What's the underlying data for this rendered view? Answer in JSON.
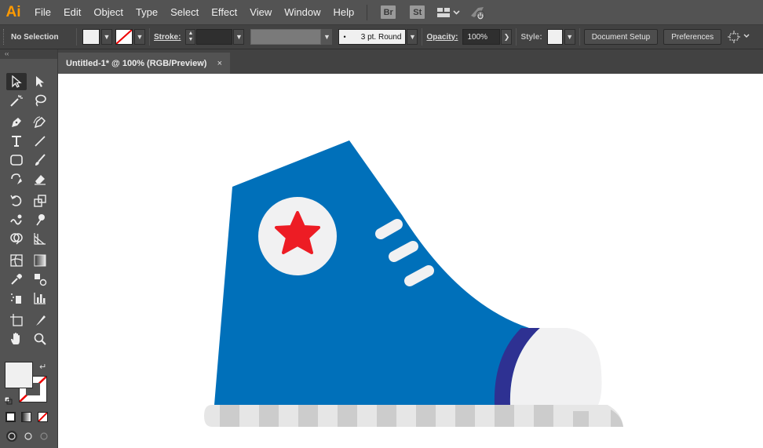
{
  "app": {
    "logo_text": "Ai"
  },
  "menu": {
    "items": [
      "File",
      "Edit",
      "Object",
      "Type",
      "Select",
      "Effect",
      "View",
      "Window",
      "Help"
    ],
    "bridge_label": "Br",
    "stock_label": "St"
  },
  "control_bar": {
    "selection_status": "No Selection",
    "stroke_label": "Stroke:",
    "brush_value": "3 pt. Round",
    "opacity_label": "Opacity:",
    "opacity_value": "100%",
    "style_label": "Style:",
    "document_setup_label": "Document Setup",
    "preferences_label": "Preferences"
  },
  "document": {
    "tab_title": "Untitled-1* @ 100% (RGB/Preview)",
    "close_glyph": "×"
  },
  "toolbox": {
    "collapse_glyph": "‹‹",
    "tools": [
      "selection-tool-icon",
      "direct-selection-tool-icon",
      "magic-wand-tool-icon",
      "lasso-tool-icon",
      "pen-tool-icon",
      "curvature-tool-icon",
      "type-tool-icon",
      "line-segment-tool-icon",
      "rectangle-tool-icon",
      "paintbrush-tool-icon",
      "shaper-tool-icon",
      "eraser-tool-icon",
      "rotate-tool-icon",
      "scale-tool-icon",
      "warp-tool-icon",
      "puppet-warp-tool-icon",
      "shape-builder-tool-icon",
      "perspective-grid-tool-icon",
      "mesh-tool-icon",
      "gradient-tool-icon",
      "eyedropper-tool-icon",
      "blend-tool-icon",
      "symbol-sprayer-tool-icon",
      "column-graph-tool-icon",
      "artboard-tool-icon",
      "slice-tool-icon",
      "hand-tool-icon",
      "zoom-tool-icon"
    ]
  },
  "colors": {
    "shoe_blue": "#0070ba",
    "star_red": "#ed1c24",
    "toe_cap": "#f1f1f2",
    "toe_band": "#2e3192",
    "sole_light": "#e6e6e6",
    "sole_dark": "#cccccc",
    "fill_swatch": "#f0f0f0"
  }
}
